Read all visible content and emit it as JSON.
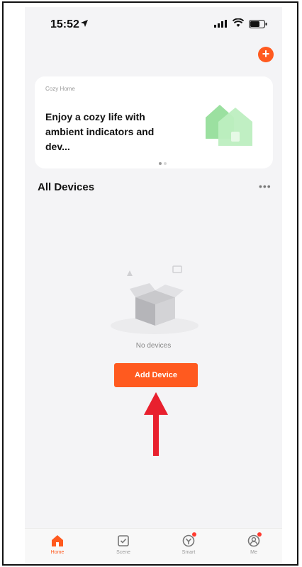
{
  "status_bar": {
    "time": "15:52"
  },
  "header": {
    "add_button_symbol": "+"
  },
  "banner": {
    "tag": "Cozy Home",
    "text": "Enjoy a cozy life with ambient indicators and dev..."
  },
  "devices": {
    "section_title": "All Devices",
    "more_symbol": "•••",
    "empty_text": "No devices",
    "add_button_label": "Add Device"
  },
  "tabs": [
    {
      "label": "Home",
      "icon": "home-icon",
      "active": true
    },
    {
      "label": "Scene",
      "icon": "scene-icon",
      "active": false
    },
    {
      "label": "Smart",
      "icon": "smart-icon",
      "active": false
    },
    {
      "label": "Me",
      "icon": "me-icon",
      "active": false
    }
  ],
  "colors": {
    "accent": "#ff5a1f",
    "annotation_arrow": "#e8202e",
    "badge": "#ff3b30"
  }
}
